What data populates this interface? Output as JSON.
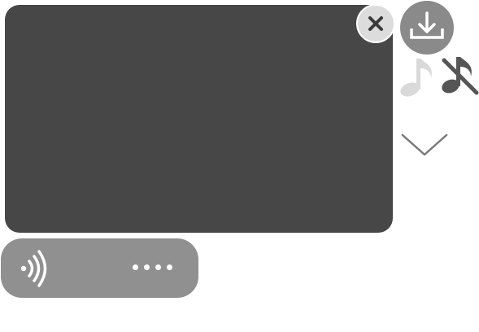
{
  "viewer": {
    "media_panel": {},
    "close_button": {
      "icon": "close-icon"
    },
    "download_button": {
      "icon": "download-icon"
    },
    "music_on_button": {
      "icon": "music-note-icon"
    },
    "music_off_button": {
      "icon": "music-muted-icon"
    },
    "collapse_button": {
      "icon": "chevron-down-icon"
    }
  },
  "audio_message": {
    "wave_icon": "audio-wave-icon",
    "progress_dots": 4
  },
  "colors": {
    "panel": "#474747",
    "close_bg": "#dcdcdc",
    "download_bg": "#8a8a8a",
    "audio_bar": "#909090",
    "music_on": "#d9d9d9",
    "music_off": "#555555",
    "chevron": "#7a7a7a"
  }
}
